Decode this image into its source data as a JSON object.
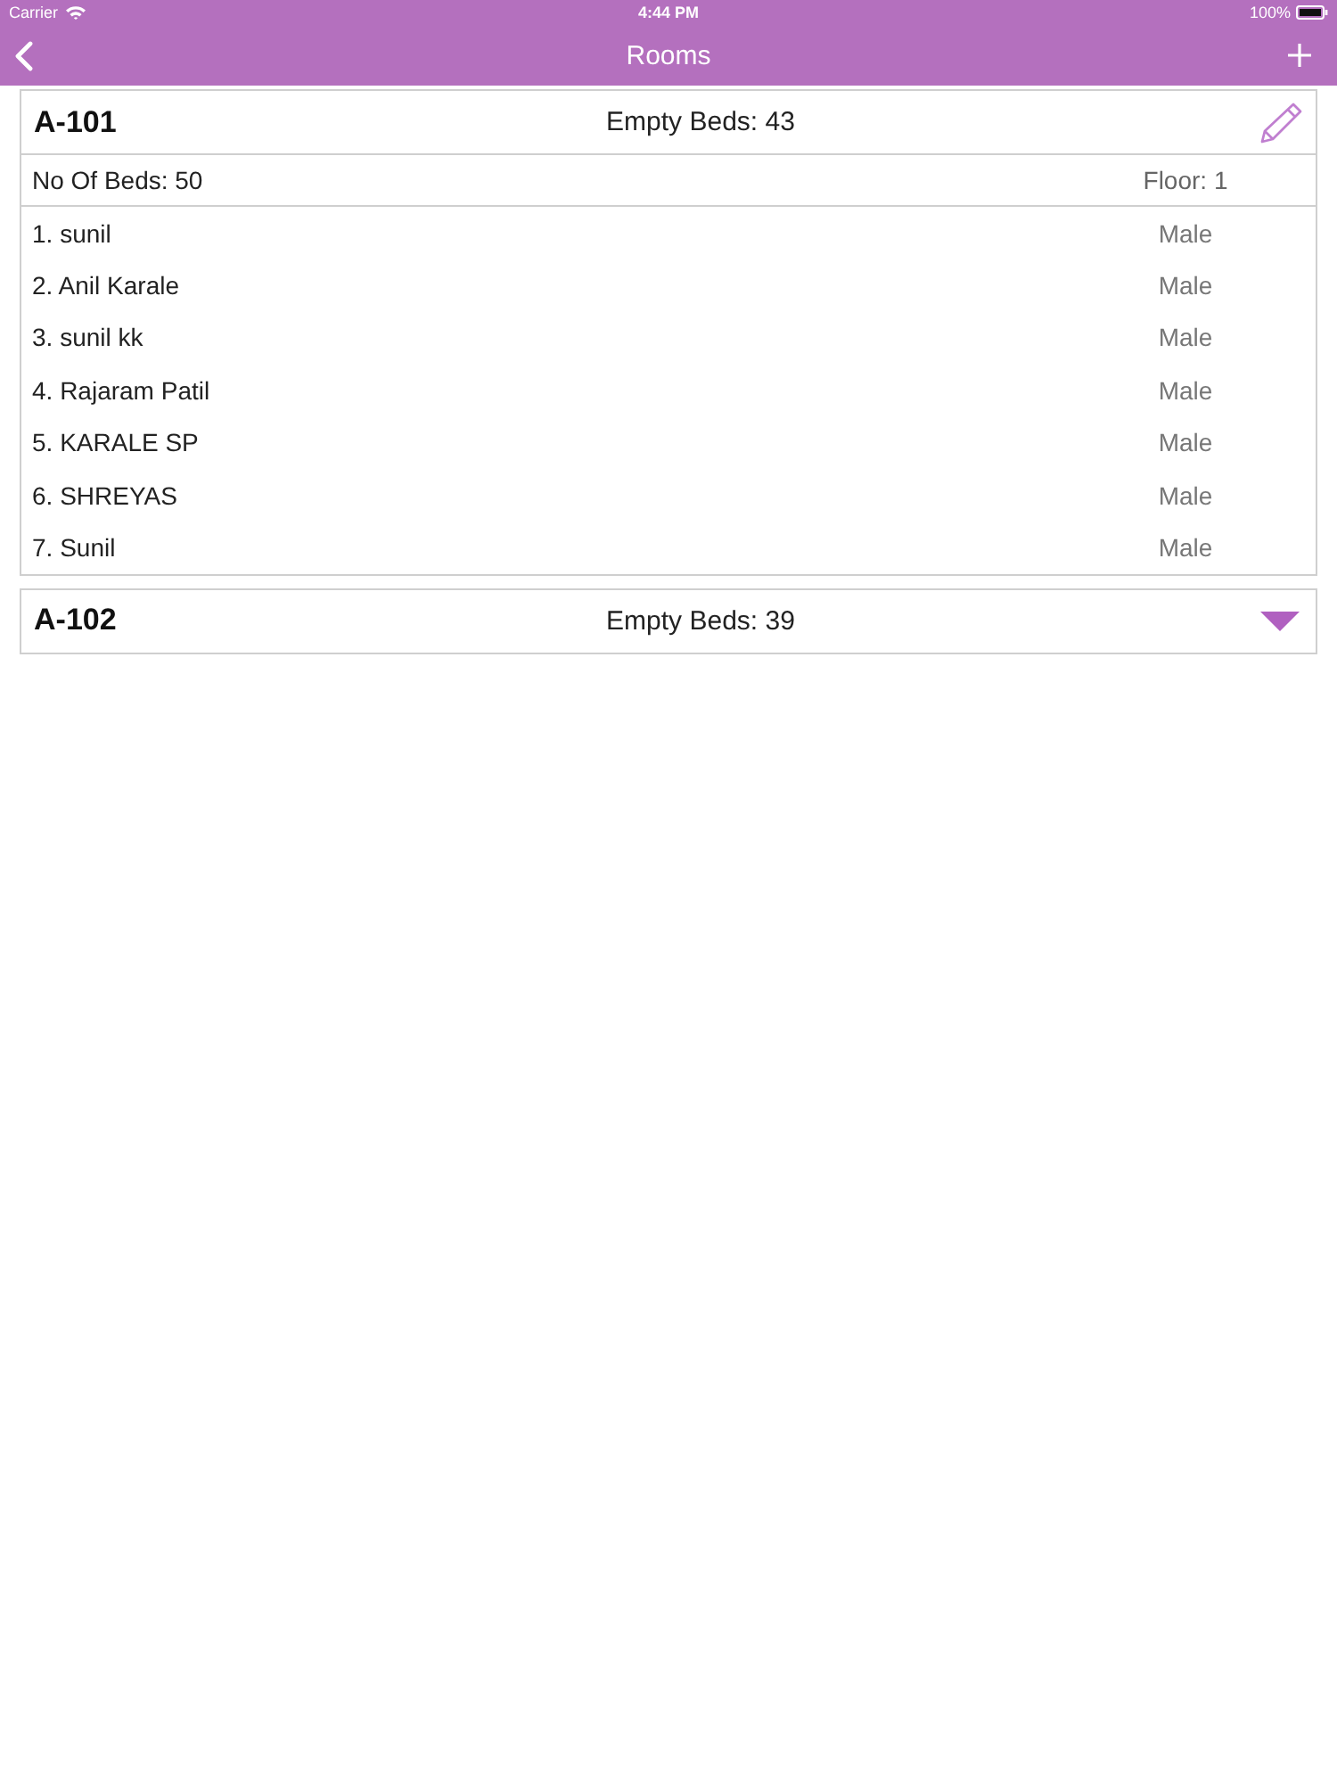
{
  "status_bar": {
    "carrier": "Carrier",
    "time": "4:44 PM",
    "battery": "100%"
  },
  "nav_bar": {
    "title": "Rooms"
  },
  "rooms": [
    {
      "name": "A-101",
      "empty_beds": "Empty Beds: 43",
      "expanded": true,
      "beds": "No Of Beds: 50",
      "floor": "Floor: 1",
      "occupants": [
        {
          "name": "1. sunil",
          "gender": "Male"
        },
        {
          "name": "2. Anil Karale",
          "gender": "Male"
        },
        {
          "name": "3. sunil kk",
          "gender": "Male"
        },
        {
          "name": "4. Rajaram Patil",
          "gender": "Male"
        },
        {
          "name": "5. KARALE SP",
          "gender": "Male"
        },
        {
          "name": "6. SHREYAS",
          "gender": "Male"
        },
        {
          "name": "7. Sunil",
          "gender": "Male"
        }
      ]
    },
    {
      "name": "A-102",
      "empty_beds": "Empty Beds: 39",
      "expanded": false
    }
  ]
}
